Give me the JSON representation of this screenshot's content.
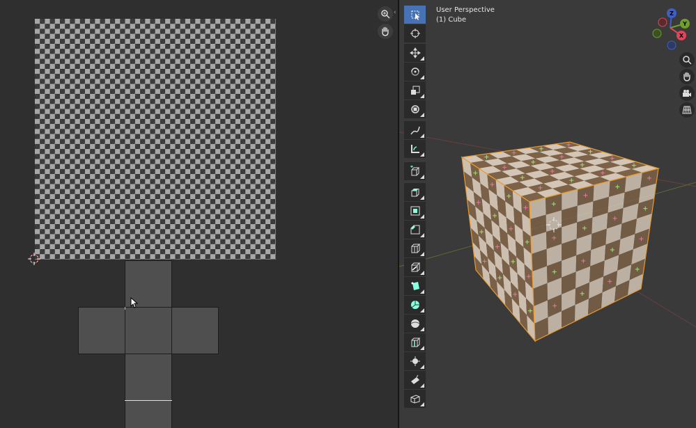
{
  "viewport": {
    "perspective_label": "User Perspective",
    "object_label": "(1) Cube"
  },
  "gizmo": {
    "axes": [
      {
        "label": "Z",
        "color": "#3f5fc6"
      },
      {
        "label": "Y",
        "color": "#6ea02a"
      },
      {
        "label": "X",
        "color": "#e0455b"
      }
    ]
  },
  "colors": {
    "uv_editor_bg": "#2f2f2f",
    "viewport_bg": "#3a3a3a",
    "toolbar_bg": "#2a2a2a",
    "active_tool": "#4772b3",
    "cube_light": "#d4c6b6",
    "cube_dark": "#7d6247"
  },
  "toolbar": {
    "tools": [
      {
        "name": "select-box-tool",
        "icon": "select-box-icon",
        "active": true
      },
      {
        "name": "cursor-tool",
        "icon": "cursor-icon"
      },
      {
        "name": "move-tool",
        "icon": "move-icon"
      },
      {
        "name": "rotate-tool",
        "icon": "rotate-icon"
      },
      {
        "name": "scale-tool",
        "icon": "scale-icon"
      },
      {
        "name": "transform-tool",
        "icon": "transform-icon"
      },
      {
        "name": "annotate-tool",
        "icon": "annotate-icon"
      },
      {
        "name": "measure-tool",
        "icon": "measure-icon"
      },
      {
        "name": "add-cube-tool",
        "icon": "add-cube-icon"
      },
      {
        "name": "extrude-tool",
        "icon": "extrude-icon"
      },
      {
        "name": "inset-tool",
        "icon": "inset-icon"
      },
      {
        "name": "bevel-tool",
        "icon": "bevel-icon"
      },
      {
        "name": "loop-cut-tool",
        "icon": "loop-cut-icon"
      },
      {
        "name": "knife-tool",
        "icon": "knife-icon"
      },
      {
        "name": "poly-build-tool",
        "icon": "poly-build-icon"
      },
      {
        "name": "spin-tool",
        "icon": "spin-icon"
      },
      {
        "name": "smooth-tool",
        "icon": "smooth-icon"
      },
      {
        "name": "edge-slide-tool",
        "icon": "edge-slide-icon"
      },
      {
        "name": "shrink-fatten-tool",
        "icon": "shrink-fatten-icon"
      },
      {
        "name": "shear-tool",
        "icon": "shear-icon"
      },
      {
        "name": "rip-region-tool",
        "icon": "rip-region-icon"
      }
    ]
  },
  "navigation": {
    "uv_buttons": [
      {
        "name": "zoom-button",
        "icon": "zoom-icon"
      },
      {
        "name": "pan-button",
        "icon": "hand-icon"
      }
    ],
    "viewport_buttons": [
      {
        "name": "zoom-button",
        "icon": "zoom-icon"
      },
      {
        "name": "pan-button",
        "icon": "hand-icon"
      },
      {
        "name": "camera-view-button",
        "icon": "camera-icon"
      },
      {
        "name": "ortho-toggle-button",
        "icon": "grid-icon"
      }
    ]
  }
}
